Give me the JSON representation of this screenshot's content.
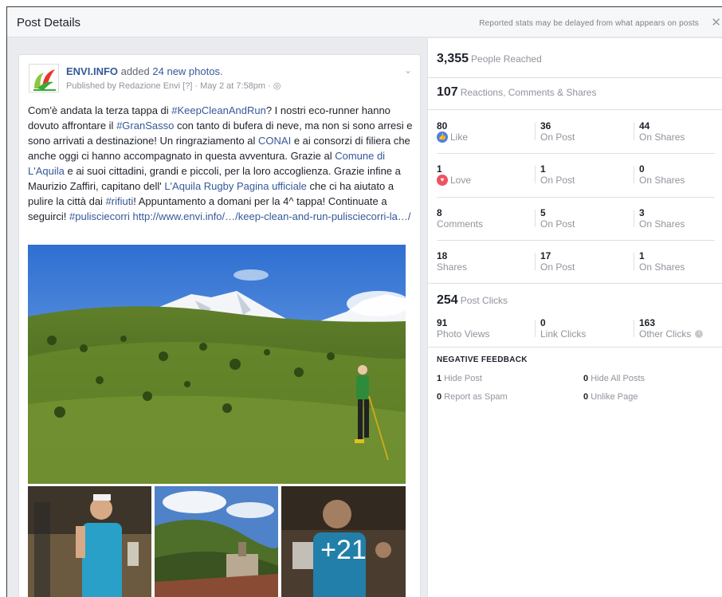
{
  "dialog": {
    "title": "Post Details",
    "delay_note": "Reported stats may be delayed from what appears on posts",
    "close_glyph": "✕"
  },
  "post": {
    "page_name": "ENVI.INFO",
    "added_text": " added ",
    "photos_link": "24 new photos",
    "period": ".",
    "published_by": "Published by Redazione Envi [?] · May 2 at 7:58pm · ",
    "globe_glyph": "◎",
    "menu_glyph": "⌄",
    "text": {
      "p1": "Com'è andata la terza tappa di ",
      "h1": "#KeepCleanAndRun",
      "p2": "? I nostri eco-runner hanno dovuto affrontare il ",
      "h2": "#GranSasso",
      "p3": " con tanto di bufera di neve, ma non si sono arresi e sono arrivati a destinazione! Un ringraziamento al ",
      "h3": "CONAI",
      "p4": " e ai consorzi di filiera che anche oggi ci hanno accompagnato in questa avventura. Grazie al ",
      "h4": "Comune di L'Aquila",
      "p5": " e ai suoi cittadini, grandi e piccoli, per la loro accoglienza. Grazie infine a Maurizio Zaffiri, capitano dell' ",
      "h5": "L'Aquila Rugby Pagina ufficiale",
      "p6": " che ci ha aiutato a pulire la città dai ",
      "h6": "#rifiuti",
      "p7": "! Appuntamento a domani per la 4^ tappa! Continuate a seguirci! ",
      "h7": "#pulisciecorri",
      "p8": " ",
      "h8": "http://www.envi.info/…/keep-clean-and-run-pulisciecorri-la…/"
    },
    "more_photos": "+21"
  },
  "stats": {
    "reached": {
      "value": "3,355",
      "label": "People Reached"
    },
    "engagement": {
      "value": "107",
      "label": "Reactions, Comments & Shares"
    },
    "rows": [
      {
        "total": "80",
        "label": "Like",
        "on_post": "36",
        "on_post_label": "On Post",
        "on_shares": "44",
        "on_shares_label": "On Shares"
      },
      {
        "total": "1",
        "label": "Love",
        "on_post": "1",
        "on_post_label": "On Post",
        "on_shares": "0",
        "on_shares_label": "On Shares"
      },
      {
        "total": "8",
        "label": "Comments",
        "on_post": "5",
        "on_post_label": "On Post",
        "on_shares": "3",
        "on_shares_label": "On Shares"
      },
      {
        "total": "18",
        "label": "Shares",
        "on_post": "17",
        "on_post_label": "On Post",
        "on_shares": "1",
        "on_shares_label": "On Shares"
      }
    ],
    "clicks": {
      "value": "254",
      "label": "Post Clicks",
      "photo_views": "91",
      "photo_views_label": "Photo Views",
      "link_clicks": "0",
      "link_clicks_label": "Link Clicks",
      "other_clicks": "163",
      "other_clicks_label": "Other Clicks"
    },
    "negative": {
      "title": "NEGATIVE FEEDBACK",
      "hide_post": "1",
      "hide_post_label": "Hide Post",
      "hide_all": "0",
      "hide_all_label": "Hide All Posts",
      "spam": "0",
      "spam_label": "Report as Spam",
      "unlike": "0",
      "unlike_label": "Unlike Page"
    }
  },
  "colors": {
    "link": "#365899",
    "muted": "#90949c",
    "like": "#4a7fe5",
    "love": "#f05261"
  },
  "icons": [
    "like-icon",
    "love-icon",
    "info-icon",
    "close-icon",
    "globe-icon",
    "chevron-down-icon"
  ]
}
